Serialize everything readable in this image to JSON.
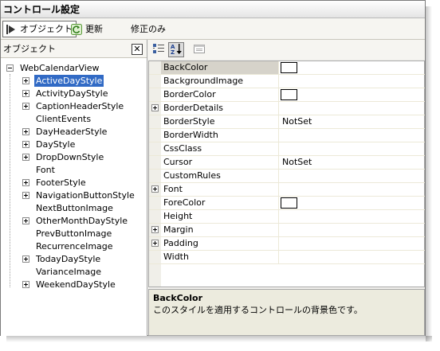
{
  "window": {
    "title": "コントロール設定"
  },
  "toolbar": {
    "objects_label": "オブジェクト",
    "objects_icon": "pointer-icon",
    "refresh_label": "更新",
    "refresh_icon": "refresh-icon",
    "modified_only_label": "修正のみ"
  },
  "left_pane": {
    "header": "オブジェクト",
    "close_glyph": "✕",
    "tree": {
      "root": "WebCalendarView",
      "items": [
        {
          "label": "ActiveDayStyle",
          "expandable": true,
          "selected": true
        },
        {
          "label": "ActivityDayStyle",
          "expandable": true
        },
        {
          "label": "CaptionHeaderStyle",
          "expandable": true
        },
        {
          "label": "ClientEvents",
          "expandable": false
        },
        {
          "label": "DayHeaderStyle",
          "expandable": true
        },
        {
          "label": "DayStyle",
          "expandable": true
        },
        {
          "label": "DropDownStyle",
          "expandable": true
        },
        {
          "label": "Font",
          "expandable": false
        },
        {
          "label": "FooterStyle",
          "expandable": true
        },
        {
          "label": "NavigationButtonStyle",
          "expandable": true
        },
        {
          "label": "NextButtonImage",
          "expandable": false
        },
        {
          "label": "OtherMonthDayStyle",
          "expandable": true
        },
        {
          "label": "PrevButtonImage",
          "expandable": false
        },
        {
          "label": "RecurrenceImage",
          "expandable": false
        },
        {
          "label": "TodayDayStyle",
          "expandable": true
        },
        {
          "label": "VarianceImage",
          "expandable": false
        },
        {
          "label": "WeekendDayStyle",
          "expandable": true
        }
      ]
    }
  },
  "property_grid": {
    "toolbar_icons": [
      "categorized-icon",
      "alphabetical-icon",
      "property-pages-icon"
    ],
    "properties": [
      {
        "name": "BackColor",
        "value": "",
        "swatch": true,
        "expandable": false,
        "selected": true
      },
      {
        "name": "BackgroundImage",
        "value": "",
        "swatch": false,
        "expandable": false
      },
      {
        "name": "BorderColor",
        "value": "",
        "swatch": true,
        "expandable": false
      },
      {
        "name": "BorderDetails",
        "value": "",
        "swatch": false,
        "expandable": true
      },
      {
        "name": "BorderStyle",
        "value": "NotSet",
        "swatch": false,
        "expandable": false
      },
      {
        "name": "BorderWidth",
        "value": "",
        "swatch": false,
        "expandable": false
      },
      {
        "name": "CssClass",
        "value": "",
        "swatch": false,
        "expandable": false
      },
      {
        "name": "Cursor",
        "value": "NotSet",
        "swatch": false,
        "expandable": false
      },
      {
        "name": "CustomRules",
        "value": "",
        "swatch": false,
        "expandable": false
      },
      {
        "name": "Font",
        "value": "",
        "swatch": false,
        "expandable": true
      },
      {
        "name": "ForeColor",
        "value": "",
        "swatch": true,
        "expandable": false
      },
      {
        "name": "Height",
        "value": "",
        "swatch": false,
        "expandable": false
      },
      {
        "name": "Margin",
        "value": "",
        "swatch": false,
        "expandable": true
      },
      {
        "name": "Padding",
        "value": "",
        "swatch": false,
        "expandable": true
      },
      {
        "name": "Width",
        "value": "",
        "swatch": false,
        "expandable": false
      }
    ],
    "description": {
      "title": "BackColor",
      "text": "このスタイルを適用するコントロールの背景色です。"
    }
  },
  "colors": {
    "selection": "#316ac5",
    "selected_property": "#d6d3ca",
    "description_bg": "#ecebde"
  }
}
